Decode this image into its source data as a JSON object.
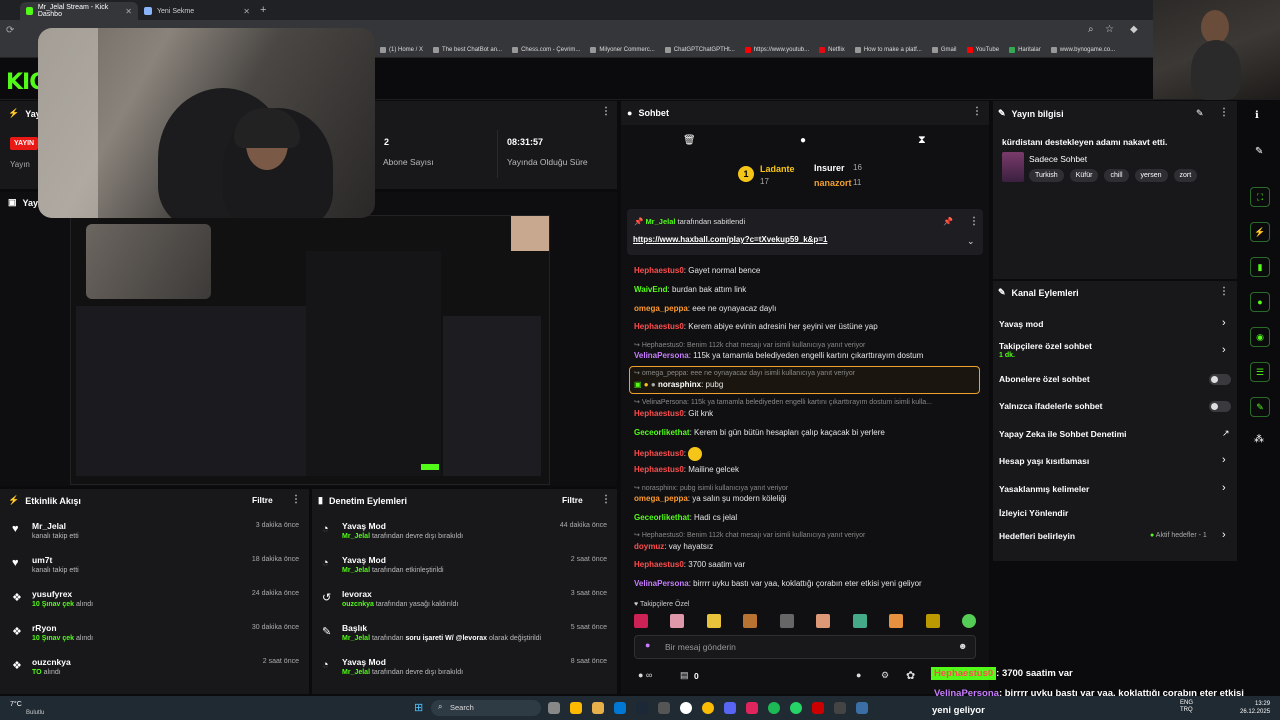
{
  "browser": {
    "tabs": [
      {
        "title": "Mr_Jelal Stream - Kick Dashbo"
      },
      {
        "title": "Yeni Sekme"
      }
    ],
    "bookmarks": [
      "(1) Home / X",
      "The best ChatBot an...",
      "Chess.com - Çevrim...",
      "Milyoner Commerc...",
      "ChatGPTChatGPTHt...",
      "https://www.youtub...",
      "Netflix",
      "How to make a platf...",
      "Gmail",
      "YouTube",
      "Haritalar",
      "www.bynogame.co..."
    ]
  },
  "stats": {
    "partial_title": "Yayı",
    "live_badge": "YAYIN",
    "partial_label": "Yayın",
    "subs_value": "2",
    "subs_label": "Abone Sayısı",
    "uptime_value": "08:31:57",
    "uptime_label": "Yayında Olduğu Süre",
    "partial_title2": "Yayı"
  },
  "activity": {
    "title": "Etkinlik Akışı",
    "filter": "Filtre",
    "items": [
      {
        "name": "Mr_Jelal",
        "detail": "kanalı takip etti",
        "time": "3 dakika önce"
      },
      {
        "name": "um7t",
        "detail": "kanalı takip etti",
        "time": "18 dakika önce"
      },
      {
        "name": "yusufyrex",
        "highlight": "10 Şınav çek",
        "detail": "alındı",
        "time": "24 dakika önce"
      },
      {
        "name": "rRyon",
        "highlight": "10 Şınav çek",
        "detail": "alındı",
        "time": "30 dakika önce"
      },
      {
        "name": "ouzcnkya",
        "highlight": "TO",
        "detail": "alındı",
        "time": "2 saat önce"
      }
    ]
  },
  "moderation": {
    "title": "Denetim Eylemleri",
    "filter": "Filtre",
    "items": [
      {
        "title": "Yavaş Mod",
        "user": "Mr_Jelal",
        "detail": "tarafından devre dışı bırakıldı",
        "time": "44 dakika önce"
      },
      {
        "title": "Yavaş Mod",
        "user": "Mr_Jelal",
        "detail": "tarafından etkinleştirildi",
        "time": "2 saat önce"
      },
      {
        "title": "levorax",
        "user": "ouzcnkya",
        "detail": "tarafından yasağı kaldırıldı",
        "time": "3 saat önce"
      },
      {
        "title": "Başlık",
        "user": "Mr_Jelal",
        "detail": "tarafından",
        "bold": "soru işareti W/ @levorax",
        "tail": "olarak değiştirildi",
        "time": "5 saat önce"
      },
      {
        "title": "Yavaş Mod",
        "user": "Mr_Jelal",
        "detail": "tarafından devre dışı bırakıldı",
        "time": "8 saat önce"
      }
    ]
  },
  "chat": {
    "title": "Sohbet",
    "leaderboard": [
      {
        "name": "Ladante",
        "count": "17"
      },
      {
        "name": "Insurer",
        "count": "16"
      },
      {
        "name": "nanazort",
        "count": "11"
      }
    ],
    "pinned_by_user": "Mr_Jelal",
    "pinned_by_text": "tarafından sabitlendi",
    "pinned_link": "https://www.haxball.com/play?c=tXvekup59_k&p=1",
    "messages": [
      {
        "user": "Hephaestus0",
        "color": "#ff4d4d",
        "text": "Gayet normal bence"
      },
      {
        "user": "WaivEnd",
        "color": "#53fc18",
        "text": "burdan bak attım link"
      },
      {
        "user": "omega_peppa",
        "color": "#ff9a2e",
        "text": "eee ne oynayacaz daylı"
      },
      {
        "user": "Hephaestus0",
        "color": "#ff4d4d",
        "text": "Kerem abiye evinin adresini her şeyini ver üstüne yap"
      },
      {
        "reply": "Hephaestus0: Benim 112k chat mesajı var isimli kullanıcıya yanıt veriyor",
        "user": "VelinaPersona",
        "color": "#c77dff",
        "text": "115k ya tamamla belediyeden engelli kartını çıkarttırayım dostum"
      },
      {
        "reply": "omega_peppa: eee ne oynayacaz dayı isimli kullanıcıya yanıt veriyor",
        "user": "norasphinx",
        "color": "#ffffff",
        "text": "pubg"
      },
      {
        "reply": "VelinaPersona: 115k ya tamamla belediyeden engelli kartını çıkarttırayım dostum isimli kulla...",
        "user": "Hephaestus0",
        "color": "#ff4d4d",
        "text": "Git knk"
      },
      {
        "user": "Geceorlikethat",
        "color": "#53fc18",
        "text": "Kerem bi gün bütün hesapları çalıp kaçacak bi yerlere"
      },
      {
        "user": "Hephaestus0",
        "color": "#ff4d4d",
        "text": ""
      },
      {
        "user": "Hephaestus0",
        "color": "#ff4d4d",
        "text": "Mailine gelcek"
      },
      {
        "reply": "norasphinx: pubg isimli kullanıcıya yanıt veriyor",
        "user": "omega_peppa",
        "color": "#ff9a2e",
        "text": "ya salın şu modern köleliği"
      },
      {
        "user": "Geceorlikethat",
        "color": "#53fc18",
        "text": "Hadi cs jelal"
      },
      {
        "reply": "Hephaestus0: Benim 112k chat mesajı var isimli kullanıcıya yanıt veriyor",
        "user": "doymuz",
        "color": "#ff4d4d",
        "text": "vay hayatsız"
      },
      {
        "user": "Hephaestus0",
        "color": "#ff4d4d",
        "text": "3700 saatim var"
      },
      {
        "user": "VelinaPersona",
        "color": "#c77dff",
        "text": "birrrr uyku bastı var yaa, koklattığı çorabın eter etkisi yeni geliyor"
      }
    ],
    "followers_only": "Takipçilere Özel",
    "input_placeholder": "Bir mesaj gönderin",
    "viewer_count": "0"
  },
  "stream_info": {
    "title": "Yayın bilgisi",
    "stream_title": "kürdistanı destekleyen adamı nakavt etti.",
    "category": "Sadece Sohbet",
    "tags": [
      "Turkish",
      "Küfür",
      "chill",
      "yersen",
      "zort"
    ]
  },
  "channel_actions": {
    "title": "Kanal Eylemleri",
    "items": [
      {
        "label": "Yavaş mod",
        "kind": "chevron"
      },
      {
        "label": "Takipçilere özel sohbet",
        "sub": "1 dk.",
        "kind": "chevron"
      },
      {
        "label": "Abonelere özel sohbet",
        "kind": "toggle"
      },
      {
        "label": "Yalnızca ifadelerle sohbet",
        "kind": "toggle"
      },
      {
        "label": "Yapay Zeka ile Sohbet Denetimi",
        "kind": "external"
      },
      {
        "label": "Hesap yaşı kısıtlaması",
        "kind": "chevron"
      },
      {
        "label": "Yasaklanmış kelimeler",
        "kind": "chevron"
      },
      {
        "label": "İzleyici Yönlendir",
        "kind": "none"
      },
      {
        "label": "Hedefleri belirleyin",
        "kind": "chevron",
        "status": "Aktif hedefler - 1"
      }
    ]
  },
  "overlay": {
    "line1_user": "Hephaestus0",
    "line1_text": ": 3700 saatim var",
    "line2_user": "VelinaPersona",
    "line2_text": ": birrrr uyku bastı var yaa, koklattığı çorabın eter etkisi",
    "line3_text": "yeni geliyor"
  },
  "taskbar": {
    "weather_temp": "7°C",
    "weather_desc": "Bulutlu",
    "search": "Search",
    "lang1": "ENG",
    "lang2": "TRQ",
    "time": "13:29",
    "date": "26.12.2025"
  },
  "colors": {
    "accent": "#53fc18",
    "panel": "#18181b",
    "bg": "#0b0b0d"
  }
}
